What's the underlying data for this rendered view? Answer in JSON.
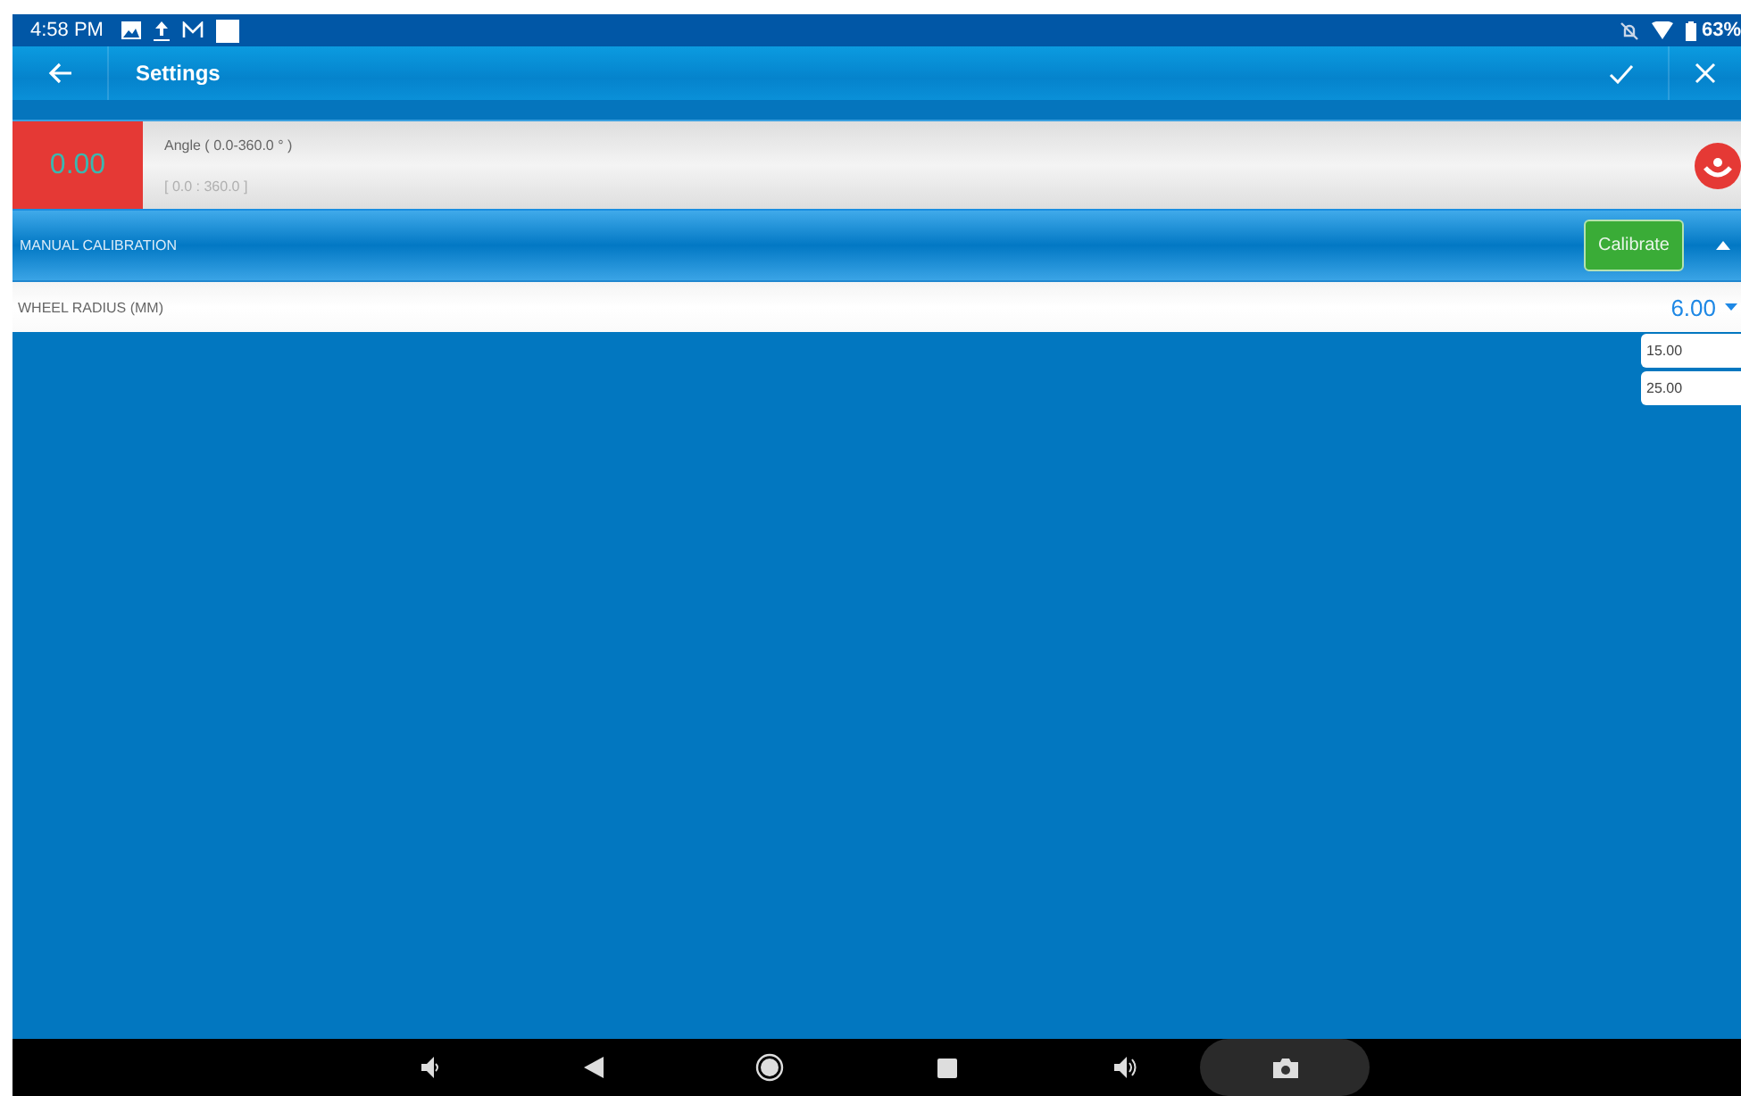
{
  "status_bar": {
    "time": "4:58 PM",
    "battery": "63%"
  },
  "app_bar": {
    "title": "Settings"
  },
  "angle": {
    "value": "0.00",
    "label": "Angle ( 0.0-360.0 ° )",
    "range": "[ 0.0 : 360.0 ]"
  },
  "section": {
    "title": "MANUAL CALIBRATION",
    "button": "Calibrate",
    "expanded": true
  },
  "field": {
    "label": "WHEEL RADIUS (MM)",
    "value": "6.00",
    "options": [
      {
        "label": "15.00"
      },
      {
        "label": "25.00"
      }
    ]
  }
}
